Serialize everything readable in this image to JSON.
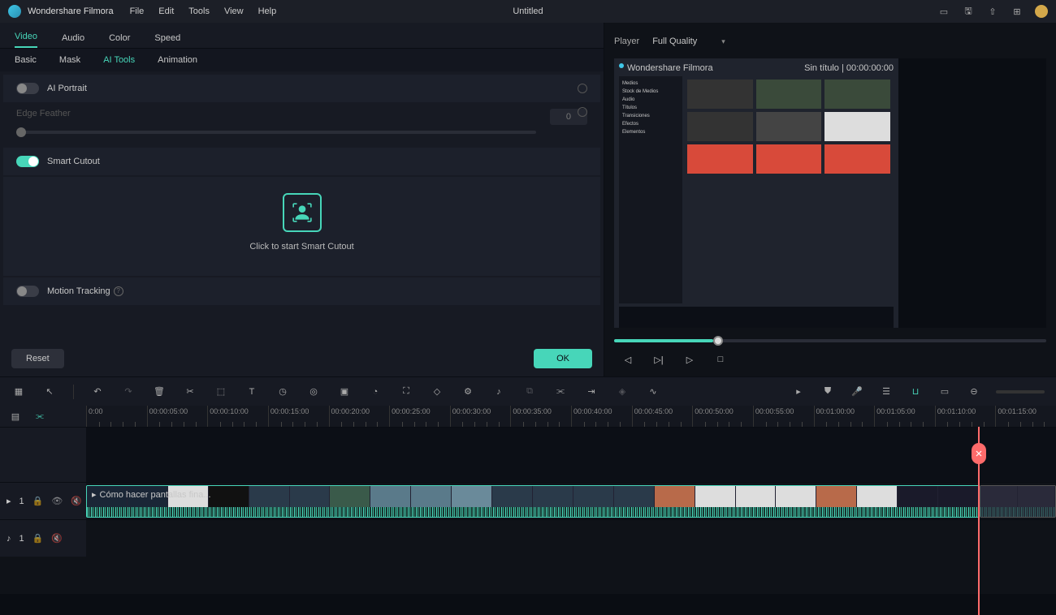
{
  "app": {
    "title": "Wondershare Filmora",
    "document": "Untitled"
  },
  "menus": [
    "File",
    "Edit",
    "Tools",
    "View",
    "Help"
  ],
  "tabs1": [
    "Video",
    "Audio",
    "Color",
    "Speed"
  ],
  "tabs1_active": 0,
  "tabs2": [
    "Basic",
    "Mask",
    "AI Tools",
    "Animation"
  ],
  "tabs2_active": 2,
  "options": {
    "ai_portrait": {
      "label": "AI Portrait",
      "on": false
    },
    "edge_feather": {
      "label": "Edge Feather",
      "value": "0"
    },
    "smart_cutout": {
      "label": "Smart Cutout",
      "on": true,
      "cta": "Click to start Smart Cutout"
    },
    "motion_tracking": {
      "label": "Motion Tracking",
      "on": false
    }
  },
  "buttons": {
    "reset": "Reset",
    "ok": "OK"
  },
  "player": {
    "label": "Player",
    "quality": "Full Quality"
  },
  "timeline": {
    "marks": [
      "0:00",
      "00:00:05:00",
      "00:00:10:00",
      "00:00:15:00",
      "00:00:20:00",
      "00:00:25:00",
      "00:00:30:00",
      "00:00:35:00",
      "00:00:40:00",
      "00:00:45:00",
      "00:00:50:00",
      "00:00:55:00",
      "00:01:00:00",
      "00:01:05:00",
      "00:01:10:00",
      "00:01:15:00"
    ],
    "clip_title": "Cómo hacer pantallas fina...",
    "video_track": "1",
    "audio_track": "1"
  }
}
